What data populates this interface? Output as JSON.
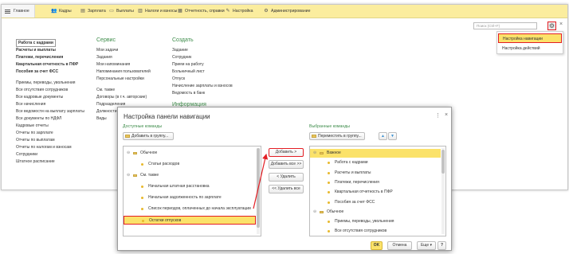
{
  "tabs": [
    {
      "label": "Главное",
      "icon": "menu-icon"
    },
    {
      "label": "Кадры",
      "icon": "people-icon"
    },
    {
      "label": "Зарплата",
      "icon": "document-icon"
    },
    {
      "label": "Выплаты",
      "icon": "wallet-icon"
    },
    {
      "label": "Налоги и взносы",
      "icon": "tax-icon"
    },
    {
      "label": "Отчетность, справки",
      "icon": "report-icon"
    },
    {
      "label": "Настройка",
      "icon": "wrench-icon"
    },
    {
      "label": "Администрирование",
      "icon": "gear-icon"
    }
  ],
  "search": {
    "placeholder": "Поиск (Ctrl+F)"
  },
  "settings_menu": {
    "items": [
      "Настройка навигации",
      "Настройка действий"
    ]
  },
  "nav": {
    "col1": {
      "bold": [
        "Работа с кадрами",
        "Расчеты и выплаты",
        "Платежи, перечисления",
        "Квартальная отчетность в ПФР",
        "Пособия за счет ФСС"
      ],
      "items": [
        "Приемы, переводы, увольнения",
        "Все отсутствия сотрудников",
        "Все кадровые документы",
        "Все начисления",
        "Все ведомости на выплату зарплаты",
        "Все документы по НДФЛ",
        "Кадровые отчеты",
        "Отчеты по зарплате",
        "Отчеты по выплатам",
        "Отчеты по налогам и взносам",
        "Сотрудники",
        "Штатное расписание"
      ]
    },
    "col2": {
      "header": "Сервис",
      "items": [
        "Мои задачи",
        "Задания",
        "Мои напоминания",
        "Напоминания пользователей",
        "Персональные настройки"
      ],
      "sub_header": "См. также",
      "sub_items": [
        "Договоры (в т.ч. авторские)",
        "Подразделения",
        "Должности",
        "Виды"
      ]
    },
    "col3": {
      "header": "Создать",
      "items": [
        "Задание",
        "Сотрудник",
        "Прием на работу",
        "Больничный лист",
        "Отпуск",
        "Начисление зарплаты и взносов",
        "Ведомость в банк"
      ],
      "sub_header": "Информация"
    }
  },
  "dialog": {
    "title": "Настройка панели навигации",
    "more": "⋮",
    "close": "×",
    "available_label": "Доступные команды",
    "selected_label": "Выбранные команды",
    "add_to_group": "Добавить в группу...",
    "move_to_group": "Переместить в группу...",
    "btn_add": "Добавить >",
    "btn_add_all": "Добавить все >>",
    "btn_remove": "< Удалить",
    "btn_remove_all": "<< Удалить все",
    "btn_ok": "OK",
    "btn_cancel": "Отмена",
    "btn_more": "Еще",
    "btn_help": "?",
    "left_list": [
      {
        "text": "Обычное",
        "level": 0,
        "kind": "group",
        "expander": "⊖"
      },
      {
        "text": "Статьи расходов",
        "level": 1,
        "kind": "item"
      },
      {
        "text": "См. также",
        "level": 0,
        "kind": "group",
        "expander": "⊖"
      },
      {
        "text": "Начальная штатная расстановка",
        "level": 1,
        "kind": "item"
      },
      {
        "text": "Начальная задолженность по зарплате",
        "level": 1,
        "kind": "item"
      },
      {
        "text": "Список периодов, оплаченных до начала эксплуатации",
        "level": 1,
        "kind": "item"
      },
      {
        "text": "Остатки отпусков",
        "level": 1,
        "kind": "item",
        "selected": true
      }
    ],
    "right_list": [
      {
        "text": "Важное",
        "level": 0,
        "kind": "group",
        "expander": "⊖",
        "selected": true
      },
      {
        "text": "Работа с кадрами",
        "level": 1,
        "kind": "item"
      },
      {
        "text": "Расчеты и выплаты",
        "level": 1,
        "kind": "item"
      },
      {
        "text": "Платежи, перечисления",
        "level": 1,
        "kind": "item"
      },
      {
        "text": "Квартальная отчетность в ПФР",
        "level": 1,
        "kind": "item"
      },
      {
        "text": "Пособия за счет ФСС",
        "level": 1,
        "kind": "item"
      },
      {
        "text": "Обычное",
        "level": 0,
        "kind": "group",
        "expander": "⊖"
      },
      {
        "text": "Приемы, переводы, увольнения",
        "level": 1,
        "kind": "item"
      },
      {
        "text": "Все отсутствия сотрудников",
        "level": 1,
        "kind": "item"
      }
    ]
  },
  "colors": {
    "accent": "#fbe26a",
    "tabbar": "#fbed9e",
    "header_green": "#3d8c4a",
    "annotation_red": "#e31e24"
  }
}
